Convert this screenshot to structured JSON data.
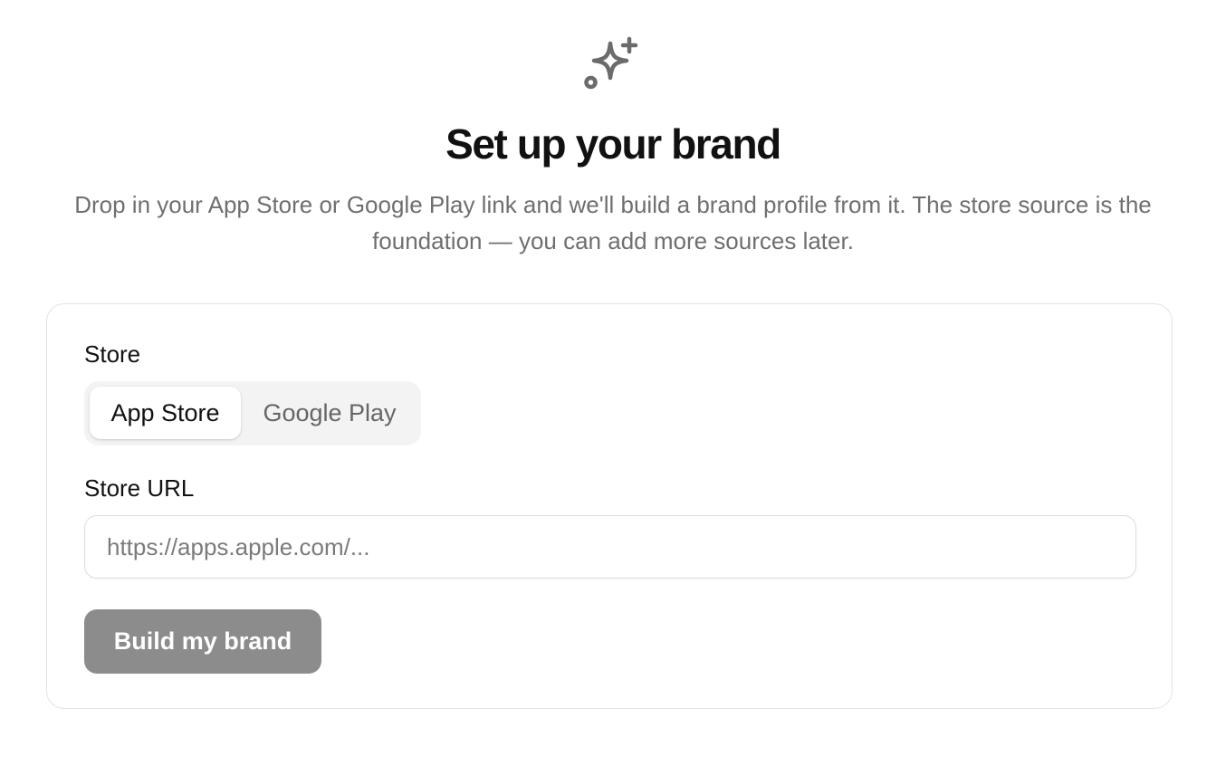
{
  "header": {
    "icon": "sparkles-icon",
    "title": "Set up your brand",
    "subtitle": "Drop in your App Store or Google Play link and we'll build a brand profile from it. The store source is the foundation — you can add more sources later."
  },
  "form": {
    "store_label": "Store",
    "store_options": [
      {
        "label": "App Store",
        "selected": true
      },
      {
        "label": "Google Play",
        "selected": false
      }
    ],
    "url_label": "Store URL",
    "url_value": "",
    "url_placeholder": "https://apps.apple.com/...",
    "submit_label": "Build my brand",
    "submit_disabled": true
  },
  "colors": {
    "title": "#111111",
    "subtitle": "#6f6f6f",
    "button_disabled_bg": "#8c8c8c",
    "segment_bg": "#f3f3f3",
    "card_border": "#e3e3e3"
  }
}
